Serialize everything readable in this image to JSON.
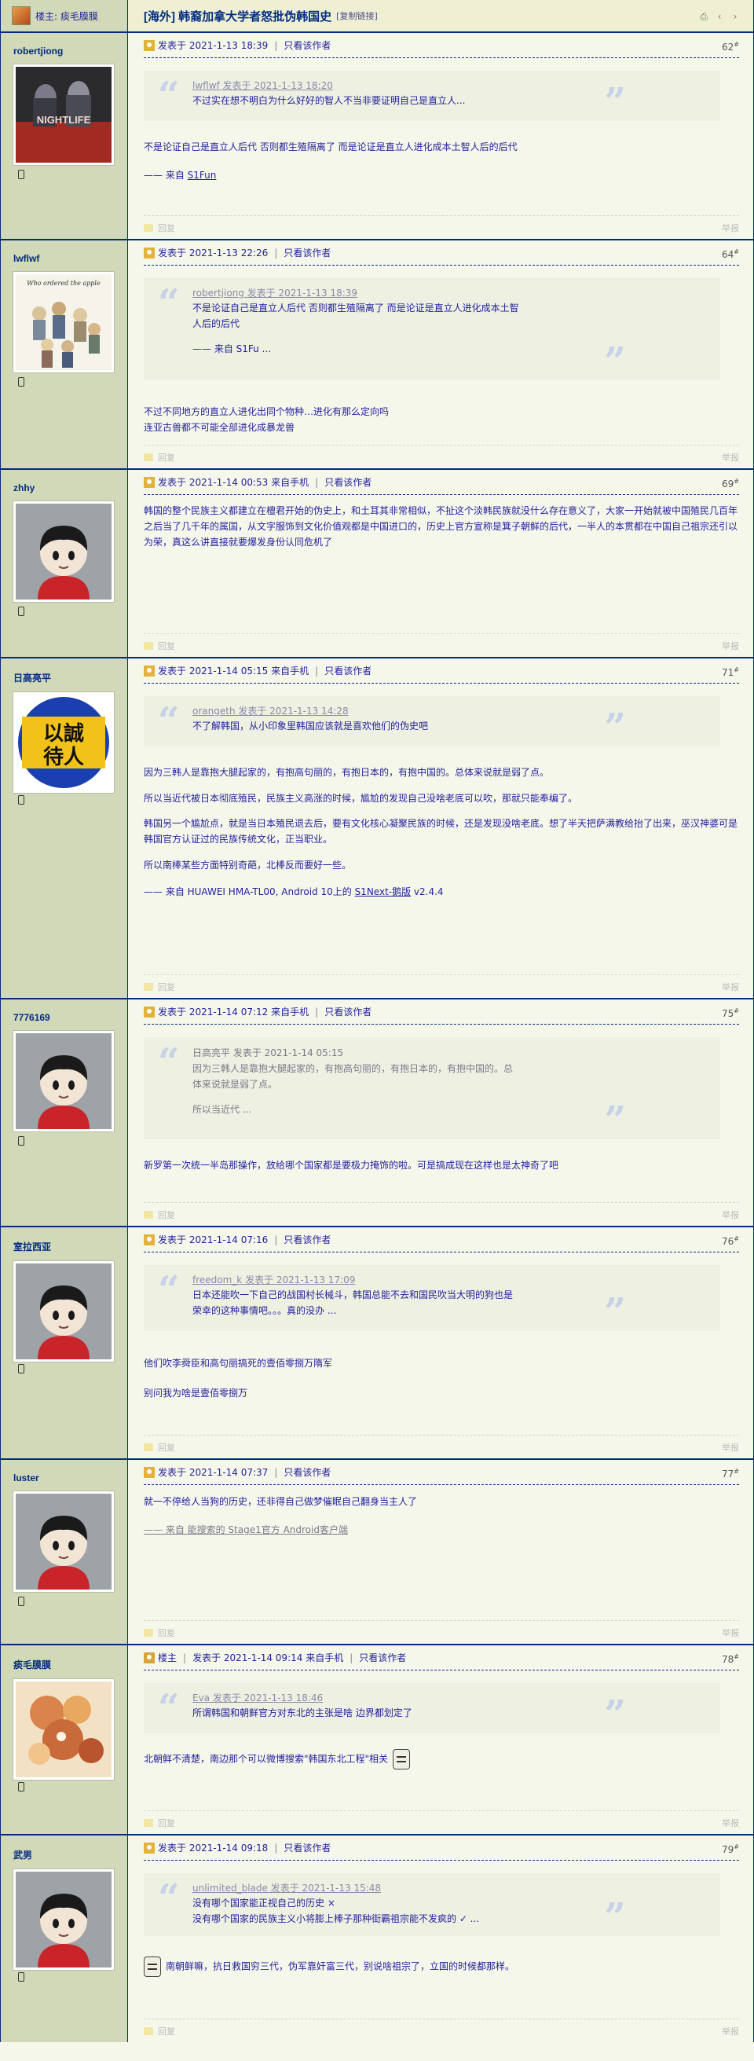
{
  "header": {
    "op_label": "楼主: 痰毛膜膜",
    "title": "[海外] 韩裔加拿大学者怒批伪韩国史",
    "copy_link": "[复制链接]"
  },
  "labels": {
    "posted_at_prefix": "发表于",
    "only_author": "只看该作者",
    "reply": "回复",
    "report": "举报",
    "op_tag": "楼主"
  },
  "posts": [
    {
      "username": "robertjiong",
      "time": "发表于 2021-1-13 18:39",
      "floor": "62",
      "quote": {
        "meta": "lwflwf 发表于 2021-1-13 18:20",
        "lines": [
          "不过实在想不明白为什么好好的智人不当非要证明自己是直立人..."
        ]
      },
      "body": [
        "不是论证自己是直立人后代 否则都生殖隔离了 而是论证是直立人进化成本土智人后的后代"
      ],
      "signature_prefix": "—— 来自 ",
      "signature_link": "S1Fun"
    },
    {
      "username": "lwflwf",
      "time": "发表于 2021-1-13 22:26",
      "floor": "64",
      "quote": {
        "meta": "robertjiong 发表于 2021-1-13 18:39",
        "lines": [
          "不是论证自己是直立人后代 否则都生殖隔离了 而是论证是直立人进化成本土智",
          "人后的后代",
          "",
          "—— 来自 S1Fu ..."
        ]
      },
      "body": [
        "不过不同地方的直立人进化出同个物种…进化有那么定向吗",
        "连亚古兽都不可能全部进化成暴龙兽"
      ]
    },
    {
      "username": "zhhy",
      "time": "发表于 2021-1-14 00:53 来自手机",
      "floor": "69",
      "body": [
        "韩国的整个民族主义都建立在檀君开始的伪史上，和土耳其非常相似，不扯这个淡韩民族就没什么存在意义了，大家一开始就被中国殖民几百年之后当了几千年的属国，从文字服饰到文化价值观都是中国进口的，历史上官方宣称是箕子朝鲜的后代，一半人的本贯都在中国自己祖宗还引以为荣，真这么讲直接就要爆发身份认同危机了"
      ]
    },
    {
      "username": "日高亮平",
      "time": "发表于 2021-1-14 05:15 来自手机",
      "floor": "71",
      "quote": {
        "meta": "orangeth 发表于 2021-1-13 14:28",
        "lines": [
          "不了解韩国，从小印象里韩国应该就是喜欢他们的伪史吧"
        ]
      },
      "body": [
        "因为三韩人是靠抱大腿起家的，有抱高句丽的，有抱日本的，有抱中国的。总体来说就是弱了点。",
        "所以当近代被日本彻底殖民，民族主义高涨的时候，尴尬的发现自己没啥老底可以吹，那就只能奉编了。",
        "韩国另一个尴尬点，就是当日本殖民退去后，要有文化核心凝聚民族的时候，还是发现没啥老底。想了半天把萨满教给抬了出来，巫汉神婆可是韩国官方认证过的民族传统文化，正当职业。",
        "所以南棒某些方面特别奇葩，北棒反而要好一些。"
      ],
      "signature_prefix": "—— 来自 HUAWEI HMA-TL00, Android 10上的 ",
      "signature_link": "S1Next-鹅版",
      "signature_suffix": " v2.4.4"
    },
    {
      "username": "7776169",
      "time": "发表于 2021-1-14 07:12 来自手机",
      "floor": "75",
      "quote": {
        "meta": "日高亮平 发表于 2021-1-14 05:15",
        "lines": [
          "因为三韩人是靠抱大腿起家的，有抱高句丽的，有抱日本的，有抱中国的。总",
          "体来说就是弱了点。",
          "",
          "所以当近代 ..."
        ],
        "grey": true
      },
      "body": [
        "新罗第一次统一半岛那操作，放给哪个国家都是要极力掩饰的啦。可是搞成现在这样也是太神奇了吧"
      ]
    },
    {
      "username": "室拉西亚",
      "time": "发表于 2021-1-14 07:16",
      "floor": "76",
      "quote": {
        "meta": "freedom_k 发表于 2021-1-13 17:09",
        "lines": [
          "日本还能吹一下自己的战国村长械斗，韩国总能不去和国民吹当大明的狗也是",
          "荣幸的这种事情吧。。。真的没办 ..."
        ]
      },
      "body": [
        "他们吹李舜臣和高句丽搞死的壹佰零捌万隋军",
        "别问我为啥是壹佰零捌万"
      ]
    },
    {
      "username": "luster",
      "time": "发表于 2021-1-14 07:37",
      "floor": "77",
      "body": [
        "就一不停给人当狗的历史，还非得自己做梦催眠自己翻身当主人了"
      ],
      "signature_grey": "—— 来自 能搜索的 Stage1官方 Android客户端"
    },
    {
      "username": "痰毛膜膜",
      "is_op": true,
      "time": "发表于 2021-1-14 09:14 来自手机",
      "floor": "78",
      "quote": {
        "meta": "Eva 发表于 2021-1-13 18:46",
        "lines": [
          "所谓韩国和朝鲜官方对东北的主张是啥 边界都划定了"
        ]
      },
      "body": [
        "北朝鲜不清楚，南边那个可以微博搜索\"韩国东北工程\"相关"
      ]
    },
    {
      "username": "武男",
      "time": "发表于 2021-1-14 09:18",
      "floor": "79",
      "quote": {
        "meta": "unlimited_blade 发表于 2021-1-13 15:48",
        "lines": [
          "没有哪个国家能正视自己的历史 ×",
          "没有哪个国家的民族主义小将膨上棒子那种街霸祖宗能不发疯的 ✓ ..."
        ]
      },
      "body": [
        "南朝鲜嘛，抗日救国穷三代，伪军靠奸富三代，别说啥祖宗了，立国的时候都那样。"
      ]
    }
  ]
}
